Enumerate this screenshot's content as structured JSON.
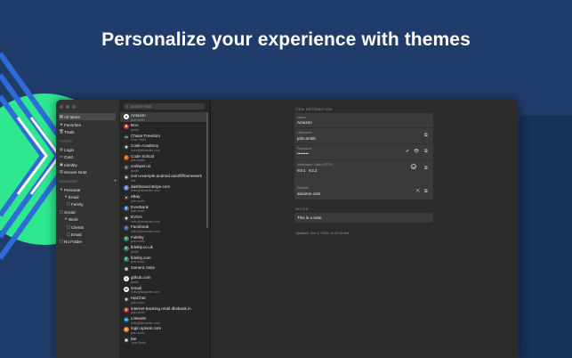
{
  "headline": "Personalize your experience with themes",
  "sidebar": {
    "items": [
      {
        "label": "All Items",
        "icon": "grid-icon",
        "glyph": "▦"
      },
      {
        "label": "Favorites",
        "icon": "star-icon",
        "glyph": "★"
      },
      {
        "label": "Trash",
        "icon": "trash-icon",
        "glyph": "🗑"
      }
    ],
    "types_header": "TYPES",
    "types": [
      {
        "label": "Login",
        "icon": "globe-icon",
        "glyph": "◍"
      },
      {
        "label": "Card",
        "icon": "card-icon",
        "glyph": "▭"
      },
      {
        "label": "Identity",
        "icon": "identity-icon",
        "glyph": "▣"
      },
      {
        "label": "Secure Note",
        "icon": "note-icon",
        "glyph": "▤"
      }
    ],
    "folders_header": "FOLDERS",
    "add_folder": "+",
    "folders": [
      {
        "label": "Personal",
        "glyph": "▾"
      },
      {
        "label": "Email",
        "glyph": "▾"
      },
      {
        "label": "Family",
        "glyph": "▢"
      },
      {
        "label": "Social",
        "glyph": "▢"
      },
      {
        "label": "Work",
        "glyph": "▾"
      },
      {
        "label": "Clients",
        "glyph": "▢"
      },
      {
        "label": "Email",
        "glyph": "▢"
      },
      {
        "label": "No Folder",
        "glyph": "▢"
      }
    ]
  },
  "search": {
    "placeholder": "Search Vault",
    "icon": "search-icon",
    "glyph": "⌕"
  },
  "vault_items": [
    {
      "name": "Amazon",
      "sub": "john.smith",
      "color": "#ffffff",
      "glyph": "a"
    },
    {
      "name": "BoA",
      "sub": "jsmith",
      "color": "#c0392b",
      "glyph": "B"
    },
    {
      "name": "Chase Freedom",
      "sub": "Visa, *4444",
      "color": "#3a3a3a",
      "glyph": "▭"
    },
    {
      "name": "Code Academy",
      "sub": "hello@bitwarden.com",
      "color": "#3a3a3a",
      "glyph": "◍"
    },
    {
      "name": "Code School",
      "sub": "john.smith",
      "color": "#d35400",
      "glyph": "C"
    },
    {
      "name": "codepen.io",
      "sub": "jsmith",
      "color": "#444444",
      "glyph": "◇"
    },
    {
      "name": "com.example.android.autofillframework",
      "sub": "test",
      "color": "#3a3a3a",
      "glyph": "◍"
    },
    {
      "name": "dashboard.stripe.com",
      "sub": "hello@bitwarden.com",
      "color": "#6772e5",
      "glyph": "S"
    },
    {
      "name": "eBay",
      "sub": "john.smith",
      "color": "#3a3a3a",
      "glyph": "e"
    },
    {
      "name": "EverBank",
      "sub": "john.smith",
      "color": "#2c6fb7",
      "glyph": "E"
    },
    {
      "name": "EVGA",
      "sub": "hello@bitwarden.com",
      "color": "#3a3a3a",
      "glyph": "◍"
    },
    {
      "name": "Facebook",
      "sub": "hello@bitwarden.com",
      "color": "#3b5998",
      "glyph": "f"
    },
    {
      "name": "Fidelity",
      "sub": "john.smith",
      "color": "#2e8b57",
      "glyph": "F"
    },
    {
      "name": "fidelity.co.uk",
      "sub": "jsmith",
      "color": "#2e8b57",
      "glyph": "F"
    },
    {
      "name": "fidelity.com",
      "sub": "john.smith",
      "color": "#2e8b57",
      "glyph": "F"
    },
    {
      "name": "Generic Note",
      "sub": "",
      "color": "#3a3a3a",
      "glyph": "▤"
    },
    {
      "name": "github.com",
      "sub": "jsmith",
      "color": "#ffffff",
      "glyph": "●"
    },
    {
      "name": "Gmail",
      "sub": "hello@bitwarden.com",
      "color": "#ffffff",
      "glyph": "M"
    },
    {
      "name": "HipChat",
      "sub": "john.smith",
      "color": "#3a3a3a",
      "glyph": "◍"
    },
    {
      "name": "internet-banking.retail.dbsbank.in",
      "sub": "john.smith",
      "color": "#c0392b",
      "glyph": "D"
    },
    {
      "name": "LinkedIn",
      "sub": "hello@bitwarden.com",
      "color": "#0077b5",
      "glyph": "in"
    },
    {
      "name": "login.splunk.com",
      "sub": "john.smith",
      "color": "#e67e22",
      "glyph": "S"
    },
    {
      "name": "Me",
      "sub": "John Smith",
      "color": "#3a3a3a",
      "glyph": "▣"
    }
  ],
  "detail": {
    "section_title": "ITEM INFORMATION",
    "name_label": "Name",
    "name_value": "Amazon",
    "username_label": "Username",
    "username_value": "john.smith",
    "password_label": "Password",
    "password_value": "••••••••",
    "totp_label": "Verification Code (TOTP)",
    "totp_value": "651 612",
    "totp_seconds": "26",
    "website_label": "Website",
    "website_value": "amazon.com",
    "notes_title": "NOTES",
    "notes_value": "This is a note.",
    "updated": "Updated: Dec 1, 2020, 11:02:55 AM"
  },
  "colors": {
    "background": "#1f3c6a",
    "accent_green": "#2ee890",
    "accent_blue": "#2f6bd6"
  }
}
